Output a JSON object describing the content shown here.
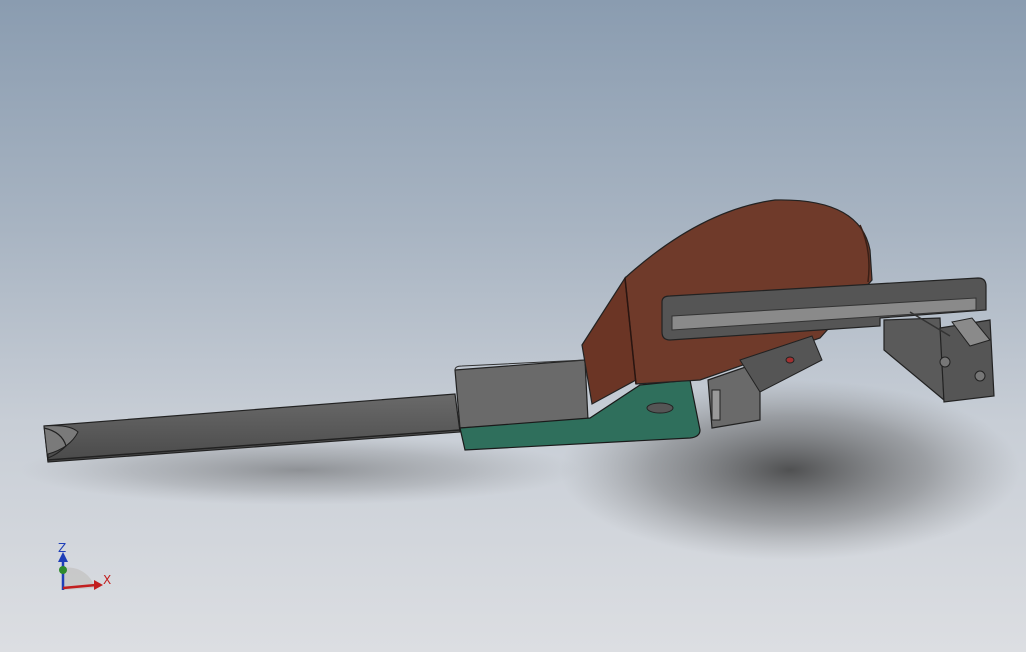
{
  "viewport": {
    "background_top": "#8a9cb0",
    "background_bottom": "#dcdee2"
  },
  "model": {
    "body_color": "#6e3a2a",
    "base_color": "#2f6f5c",
    "arm_color": "#5d5d5d",
    "rail_color": "#8a8a8a"
  },
  "triad": {
    "z_label": "Z",
    "x_label": "X",
    "z_color": "#1f3fb8",
    "x_color": "#c21f1f",
    "y_color": "#2e8b2e"
  }
}
